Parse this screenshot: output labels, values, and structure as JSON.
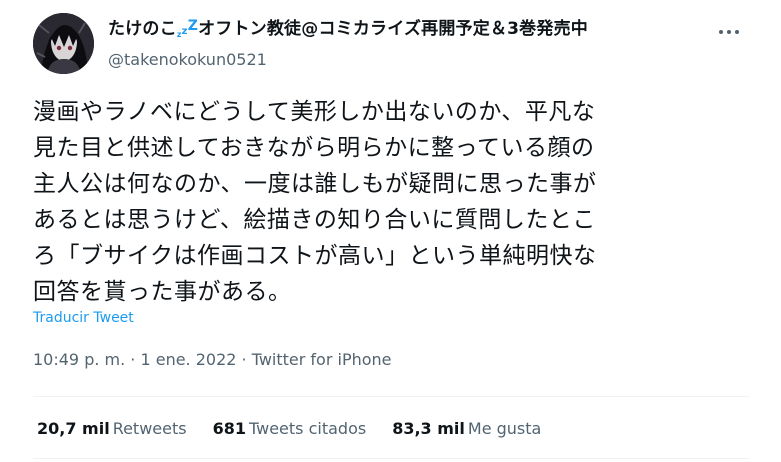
{
  "user": {
    "name_prefix": "たけのこ",
    "zzz": [
      "z",
      "z",
      "Z"
    ],
    "name_suffix": "オフトン教徒@コミカライズ再開予定＆3巻発売中",
    "handle": "@takenokokun0521"
  },
  "tweet": {
    "text": "漫画やラノベにどうして美形しか出ないのか、平凡な\n見た目と供述しておきながら明らかに整っている顔の\n主人公は何なのか、一度は誰しもが疑問に思った事が\nあるとは思うけど、絵描きの知り合いに質問したとこ\nろ「ブサイクは作画コストが高い」という単純明快な\n回答を貰った事がある。",
    "translate_label": "Traducir Tweet",
    "meta": "10:49 p. m. · 1 ene. 2022 · Twitter for iPhone"
  },
  "stats": {
    "retweets": {
      "count": "20,7 mil",
      "label": "Retweets"
    },
    "quotes": {
      "count": "681",
      "label": "Tweets citados"
    },
    "likes": {
      "count": "83,3 mil",
      "label": "Me gusta"
    }
  },
  "icons": {
    "more": "more-horizontal-icon",
    "avatar": "avatar-image"
  },
  "colors": {
    "accent": "#1d9bf0",
    "secondary_text": "#536471",
    "divider": "#eff3f4"
  }
}
